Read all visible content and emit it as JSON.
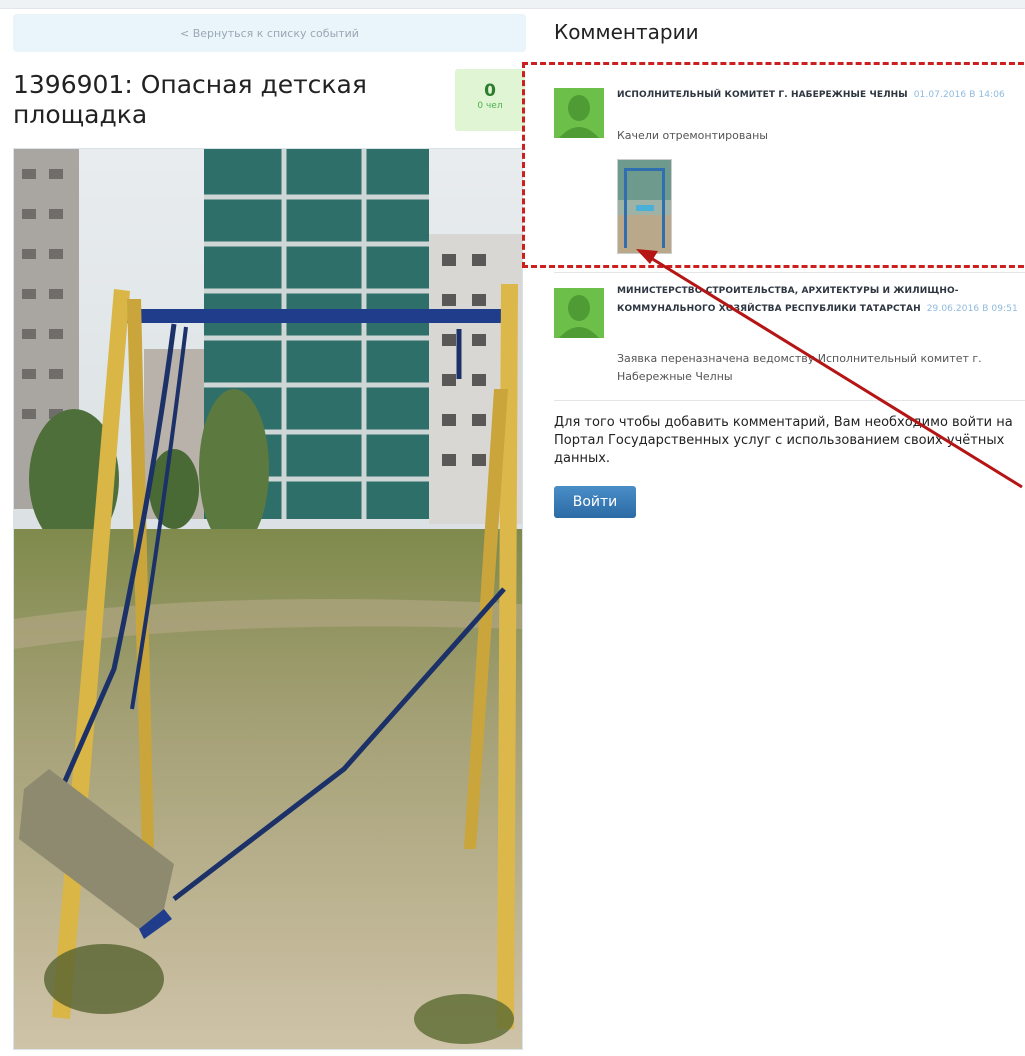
{
  "nav": {
    "back_label": "< Вернуться к списку событий"
  },
  "event": {
    "title": "1396901: Опасная детская площадка",
    "votes_count": "0",
    "votes_label": "0 чел"
  },
  "comments": {
    "section_title": "Комментарии",
    "items": [
      {
        "author": "ИСПОЛНИТЕЛЬНЫЙ КОМИТЕТ Г. НАБЕРЕЖНЫЕ ЧЕЛНЫ",
        "date": "01.07.2016 в 14:06",
        "text": "Качели отремонтированы",
        "has_attachment": true
      },
      {
        "author": "МИНИСТЕРСТВО СТРОИТЕЛЬСТВА, АРХИТЕКТУРЫ И ЖИЛИЩНО-КОММУНАЛЬНОГО ХОЗЯЙСТВА РЕСПУБЛИКИ ТАТАРСТАН",
        "date": "29.06.2016 в 09:51",
        "text": "Заявка переназначена ведомству Исполнительный комитет г. Набережные Челны"
      }
    ],
    "login_note": "Для того чтобы добавить комментарий, Вам необходимо войти на Портал Государственных услуг с использованием своих учётных данных.",
    "login_button": "Войти"
  },
  "colors": {
    "accent": "#2b6aa5",
    "highlight": "#cc1f1f",
    "avatar": "#6cc04a",
    "votes_bg": "#dff5d3"
  },
  "icons": [
    "user-avatar-icon"
  ]
}
